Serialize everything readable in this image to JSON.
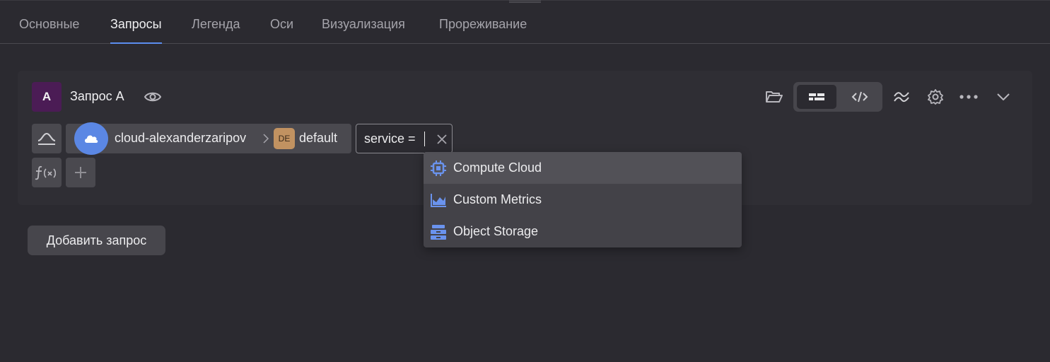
{
  "tabs": [
    {
      "label": "Основные",
      "active": false
    },
    {
      "label": "Запросы",
      "active": true
    },
    {
      "label": "Легенда",
      "active": false
    },
    {
      "label": "Оси",
      "active": false
    },
    {
      "label": "Визуализация",
      "active": false
    },
    {
      "label": "Прореживание",
      "active": false
    }
  ],
  "query": {
    "badge": "A",
    "title": "Запрос A",
    "source": {
      "cloud": "cloud-alexanderzaripov",
      "folder_badge": "DE",
      "folder": "default"
    },
    "filter_value": "service ="
  },
  "dropdown": {
    "items": [
      {
        "label": "Compute Cloud",
        "icon": "chip-icon"
      },
      {
        "label": "Custom Metrics",
        "icon": "area-chart-icon"
      },
      {
        "label": "Object Storage",
        "icon": "storage-icon"
      }
    ]
  },
  "add_query_label": "Добавить запрос",
  "colors": {
    "background": "#2b2a30",
    "accent": "#5b8def",
    "query_badge": "#4b1c55",
    "folder_badge": "#c19261",
    "dropdown_icon": "#5b87e4"
  }
}
